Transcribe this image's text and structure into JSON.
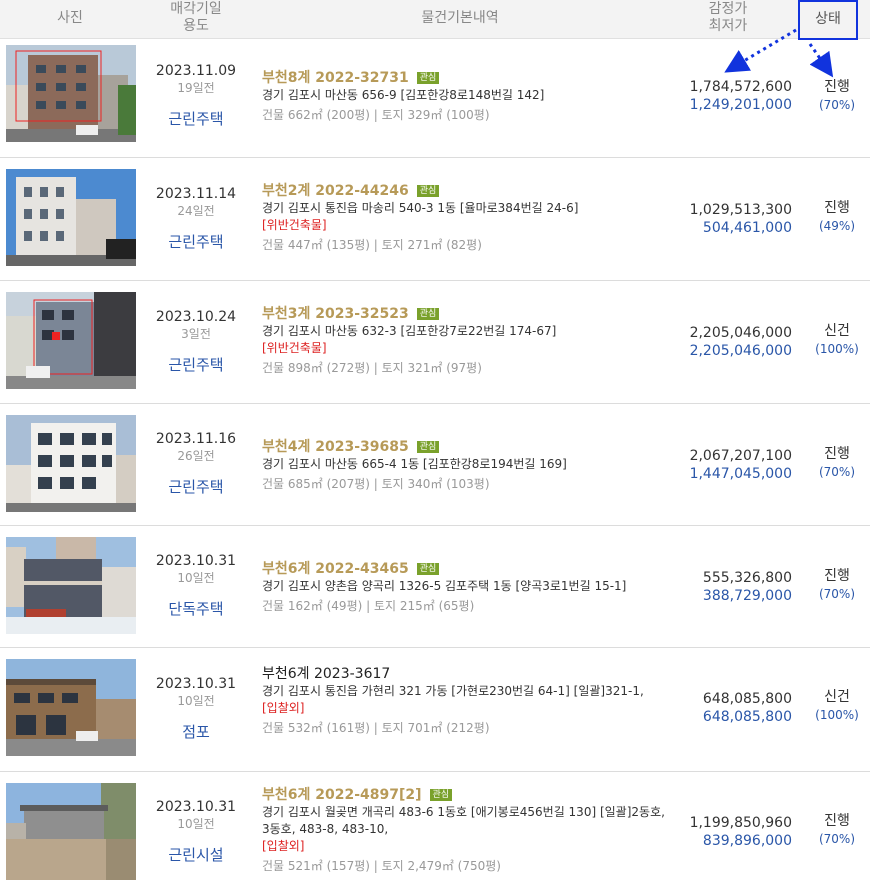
{
  "header": {
    "photo": "사진",
    "date_line1": "매각기일",
    "date_line2": "용도",
    "basic": "물건기본내역",
    "price_line1": "감정가",
    "price_line2": "최저가",
    "status": "상태"
  },
  "badge_label": "관심",
  "rows": [
    {
      "date": "2023.11.09",
      "ago": "19일전",
      "use": "근린주택",
      "case": "부천8계 2022-32731",
      "badge": true,
      "addr": "경기 김포시 마산동 656-9 [김포한강8로148번길 142]",
      "warn": "",
      "area": "건물 662㎡ (200평)   |   토지 329㎡ (100평)",
      "appraisal": "1,784,572,600",
      "minimum": "1,249,201,000",
      "status": "진행",
      "pct": "(70%)"
    },
    {
      "date": "2023.11.14",
      "ago": "24일전",
      "use": "근린주택",
      "case": "부천2계 2022-44246",
      "badge": true,
      "addr": "경기 김포시 통진읍 마송리 540-3 1동 [율마로384번길 24-6]",
      "warn": "[위반건축물]",
      "area": "건물 447㎡ (135평)   |   토지 271㎡ (82평)",
      "appraisal": "1,029,513,300",
      "minimum": "504,461,000",
      "status": "진행",
      "pct": "(49%)"
    },
    {
      "date": "2023.10.24",
      "ago": "3일전",
      "use": "근린주택",
      "case": "부천3계 2023-32523",
      "badge": true,
      "addr": "경기 김포시 마산동 632-3 [김포한강7로22번길 174-67]",
      "warn": "[위반건축물]",
      "area": "건물 898㎡ (272평)   |   토지 321㎡ (97평)",
      "appraisal": "2,205,046,000",
      "minimum": "2,205,046,000",
      "status": "신건",
      "pct": "(100%)"
    },
    {
      "date": "2023.11.16",
      "ago": "26일전",
      "use": "근린주택",
      "case": "부천4계 2023-39685",
      "badge": true,
      "addr": "경기 김포시 마산동 665-4 1동 [김포한강8로194번길 169]",
      "warn": "",
      "area": "건물 685㎡ (207평)   |   토지 340㎡ (103평)",
      "appraisal": "2,067,207,100",
      "minimum": "1,447,045,000",
      "status": "진행",
      "pct": "(70%)"
    },
    {
      "date": "2023.10.31",
      "ago": "10일전",
      "use": "단독주택",
      "case": "부천6계 2022-43465",
      "badge": true,
      "addr": "경기 김포시 양촌읍 양곡리 1326-5 김포주택 1동 [양곡3로1번길 15-1]",
      "warn": "",
      "area": "건물 162㎡ (49평)   |   토지 215㎡ (65평)",
      "appraisal": "555,326,800",
      "minimum": "388,729,000",
      "status": "진행",
      "pct": "(70%)"
    },
    {
      "date": "2023.10.31",
      "ago": "10일전",
      "use": "점포",
      "case": "부천6계 2023-3617",
      "badge": false,
      "addr": "경기 김포시 통진읍 가현리 321 가동 [가현로230번길 64-1]  [일괄]321-1,",
      "warn": "[입찰외]",
      "area": "건물 532㎡ (161평)   |   토지 701㎡ (212평)",
      "appraisal": "648,085,800",
      "minimum": "648,085,800",
      "status": "신건",
      "pct": "(100%)"
    },
    {
      "date": "2023.10.31",
      "ago": "10일전",
      "use": "근린시설",
      "case": "부천6계 2022-4897[2]",
      "badge": true,
      "addr": "경기 김포시 월곶면 개곡리 483-6 1동호 [애기봉로456번길 130]  [일괄]2동호, 3동호, 483-8, 483-10,",
      "warn": "[입찰외]",
      "area": "건물 521㎡ (157평)   |   토지 2,479㎡ (750평)",
      "appraisal": "1,199,850,960",
      "minimum": "839,896,000",
      "status": "진행",
      "pct": "(70%)"
    }
  ],
  "colors": {
    "case": "#b79a58",
    "blue": "#2a56a8",
    "warn": "#dd2222",
    "badge": "#7aa12b",
    "highlight": "#1133dd"
  }
}
